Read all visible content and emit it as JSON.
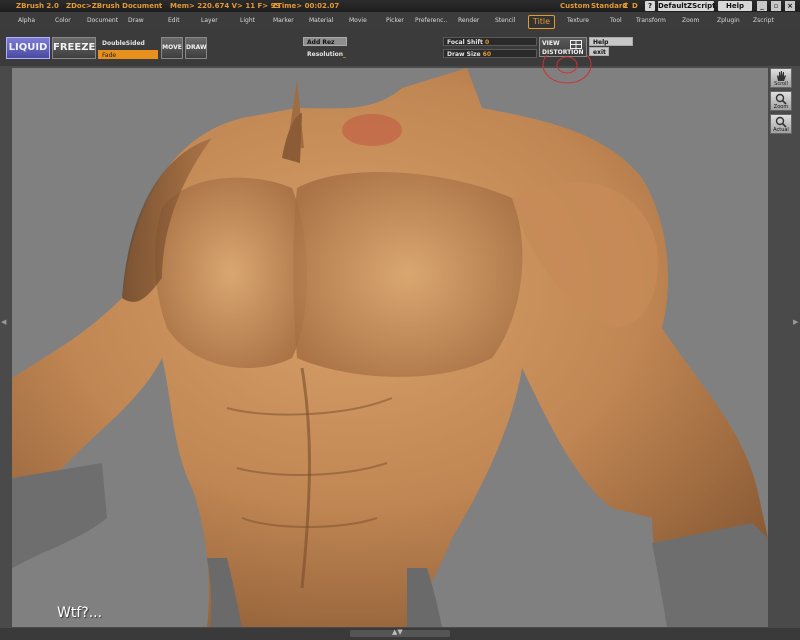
{
  "titlebar": {
    "app": "ZBrush 2.0",
    "doc": "ZDoc>ZBrush Document",
    "mem": "Mem> 220.674  V> 11  F> 99",
    "time": "ZTime> 00:02.07",
    "custom": "Custom",
    "standard": "Standard",
    "z": "Z",
    "d": "D",
    "q": "?",
    "defaultzscript": "DefaultZScript",
    "help": "Help"
  },
  "menu": {
    "items": [
      "Alpha",
      "Color",
      "Document",
      "Draw",
      "Edit",
      "Layer",
      "Light",
      "Marker",
      "Material",
      "Movie",
      "Picker",
      "Preferenc..",
      "Render",
      "Stencil",
      "Texture",
      "Tool",
      "Transform",
      "Zoom",
      "Zplugin",
      "Zscript"
    ],
    "title": "Title"
  },
  "toolbar": {
    "liquid": "LIQUID",
    "freeze": "FREEZE",
    "doublesided": "DoubleSided",
    "fade": "Fade",
    "move": "MOVE",
    "draw": "DRAW",
    "add_rez": "Add Rez",
    "resolution": "Resolution",
    "resolution_val": "_",
    "focal_shift": "Focal Shift",
    "focal_shift_val": "0",
    "draw_size": "Draw Size",
    "draw_size_val": "60",
    "view": "VIEW",
    "distortion": "DISTORTION",
    "help": "Help",
    "exit": "exit"
  },
  "side": {
    "scroll": "Scroll",
    "zoom": "Zoom",
    "actual": "Actual"
  },
  "canvas": {
    "caption": "Wtf?..."
  },
  "colors": {
    "accent": "#e39a33",
    "liquid": "#6a6ac8",
    "skin": "#c98f5c",
    "canvas": "#808080"
  }
}
